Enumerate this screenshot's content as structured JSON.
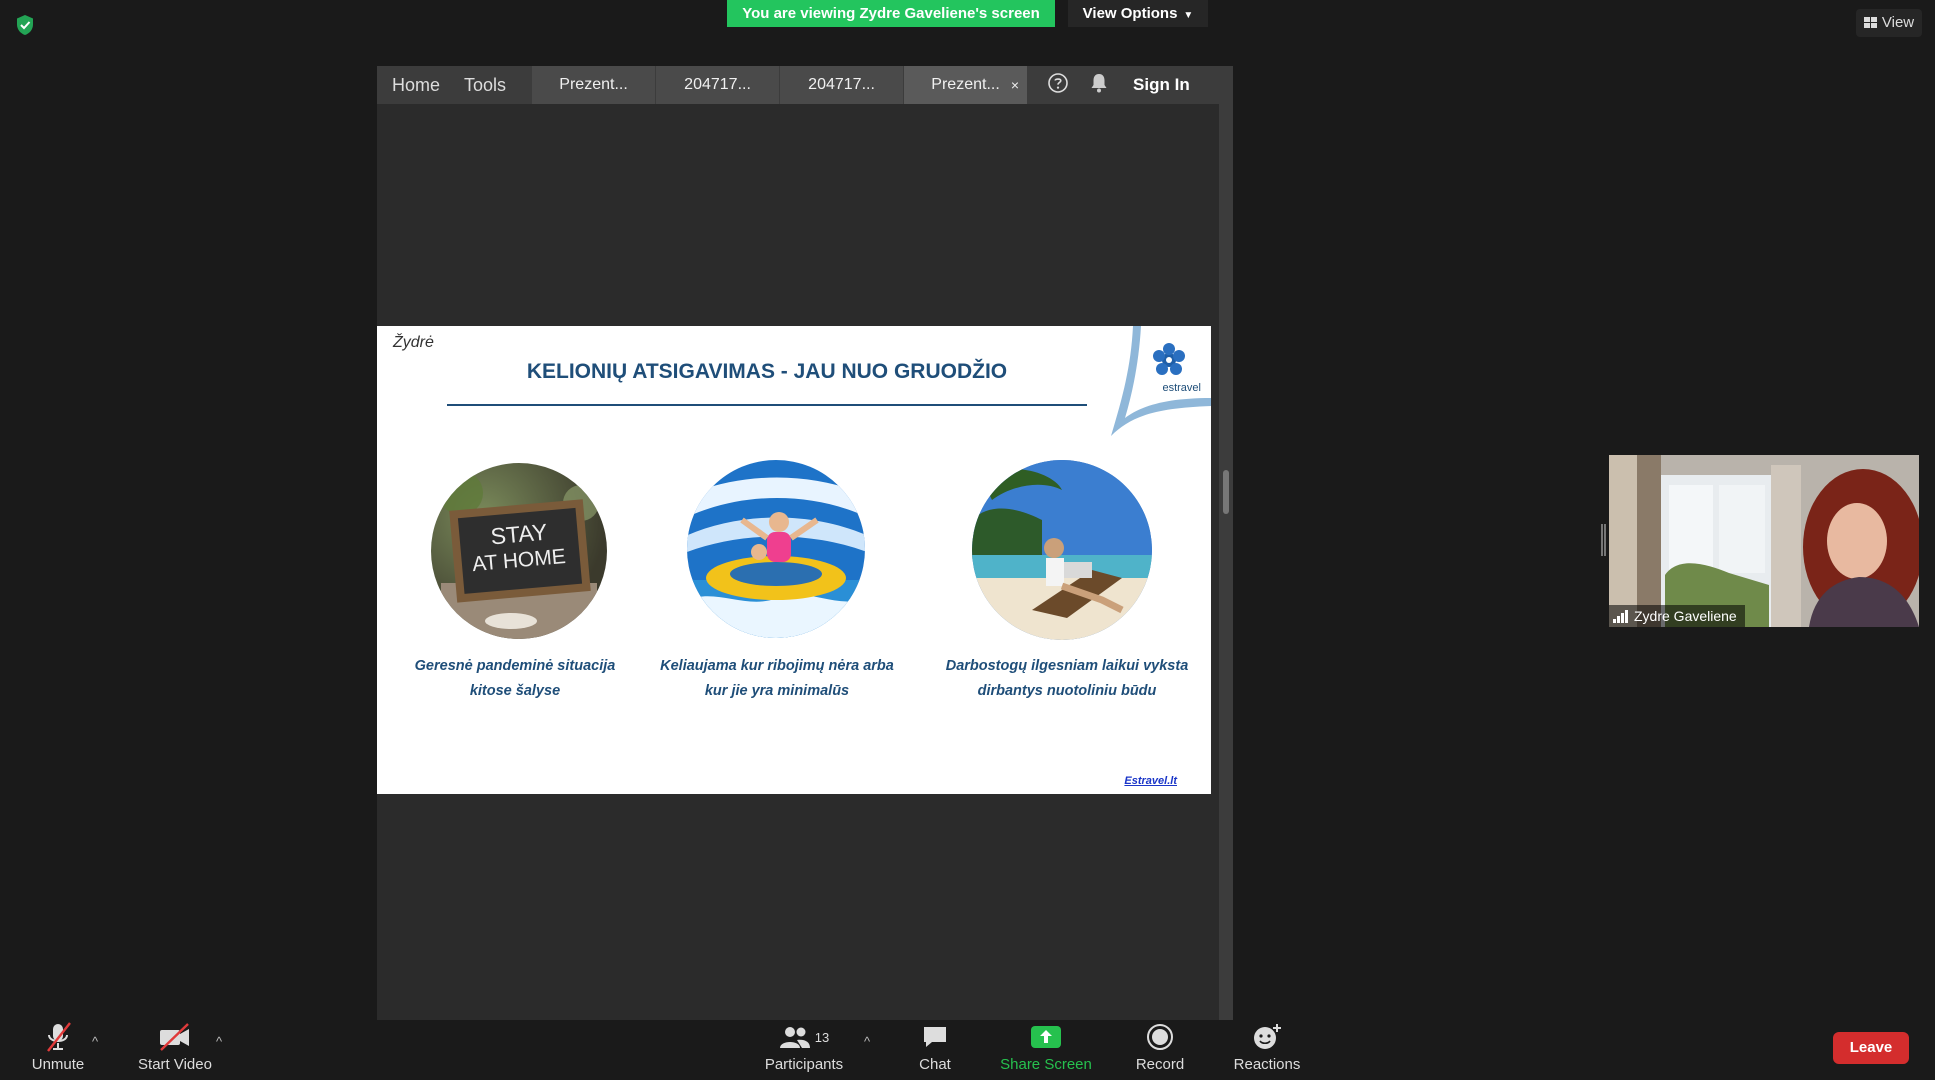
{
  "top_bar": {
    "viewing_banner": "You are viewing Zydre Gaveliene's screen",
    "view_options_label": "View Options",
    "view_button_label": "View",
    "security_icon": "shield-check-icon"
  },
  "shared_app": {
    "toolbar": {
      "home": "Home",
      "tools": "Tools",
      "tabs": [
        {
          "label": "Prezent..."
        },
        {
          "label": "204717..."
        },
        {
          "label": "204717..."
        },
        {
          "label": "Prezent..."
        }
      ],
      "close_glyph": "×",
      "sign_in": "Sign In",
      "help_icon": "help-circle-icon",
      "notification_icon": "bell-icon"
    },
    "slide": {
      "author": "Žydrė",
      "title": "KELIONIŲ ATSIGAVIMAS - JAU NUO GRUODŽIO",
      "brand_name": "estravel",
      "image_1_text": [
        "STAY",
        "AT HOME"
      ],
      "captions": [
        [
          "Geresnė pandeminė situacija",
          "kitose šalyse"
        ],
        [
          "Keliaujama kur ribojimų nėra arba",
          "kur jie yra minimalūs"
        ],
        [
          "Darbostogų ilgesniam laikui vyksta",
          "dirbantys nuotoliniu būdu"
        ]
      ],
      "footer_link": "Estravel.lt"
    }
  },
  "participant_tile": {
    "name": "Zydre Gaveliene"
  },
  "controls": {
    "unmute": "Unmute",
    "start_video": "Start Video",
    "participants": "Participants",
    "participants_count": "13",
    "chat": "Chat",
    "share_screen": "Share Screen",
    "record": "Record",
    "reactions": "Reactions",
    "leave": "Leave",
    "caret_glyph": "^"
  },
  "colors": {
    "banner_green": "#23c55e",
    "share_green": "#26c14e",
    "leave_red": "#d42d2d",
    "slide_blue": "#1f4e79"
  }
}
